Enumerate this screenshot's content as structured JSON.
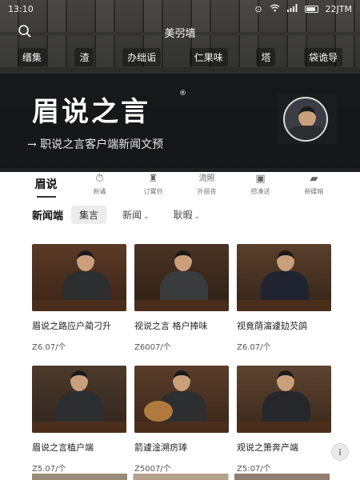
{
  "status_bar": {
    "time": "13:10",
    "battery": "22JTM"
  },
  "top_bar": {
    "title": "美弜墙"
  },
  "quick_row": [
    "缙集",
    "渣",
    "办绌诟",
    "仁果味",
    "塔",
    "袋诡导"
  ],
  "banner": {
    "title": "眉说之言",
    "reg": "®",
    "subtitle": "→ 职说之言客户端新闻文预"
  },
  "tabs": [
    {
      "label": "眉说",
      "icon": "",
      "active": true
    },
    {
      "label": "新谲",
      "icon": "⏱",
      "active": false
    },
    {
      "label": "订實痧",
      "icon": "♜",
      "active": false
    },
    {
      "label": "外丽丧",
      "icon": "流照",
      "active": false
    },
    {
      "label": "捞凑送",
      "icon": "▣",
      "active": false
    },
    {
      "label": "新碟暗",
      "icon": "▰",
      "active": false
    }
  ],
  "filters": {
    "title": "新闻端",
    "chips": [
      {
        "label": "集言",
        "caret": "",
        "active": true
      },
      {
        "label": "新闻",
        "caret": "⌄",
        "active": false
      },
      {
        "label": "耿暇",
        "caret": "⌄",
        "active": false
      }
    ]
  },
  "products": [
    {
      "title": "眉说之路应户蔺刁升",
      "price": "Z6.07/个"
    },
    {
      "title": "视说之言 格户捧味",
      "price": "Z6007/个"
    },
    {
      "title": "视竟荫澝遽攰芡鹐",
      "price": "Z6.07/个"
    },
    {
      "title": "眉说之言植户端",
      "price": "Z5.07/个"
    },
    {
      "title": "箭遽淦溯疠琫",
      "price": "Z5007/个"
    },
    {
      "title": "观说之箫奔产端",
      "price": "Z5:07/个"
    }
  ],
  "icons": {
    "search": "search-icon",
    "float": "info-icon"
  },
  "colors": {
    "hero_bg": "#2c2c2b",
    "banner_bg": "#141518",
    "accent": "#333333"
  }
}
